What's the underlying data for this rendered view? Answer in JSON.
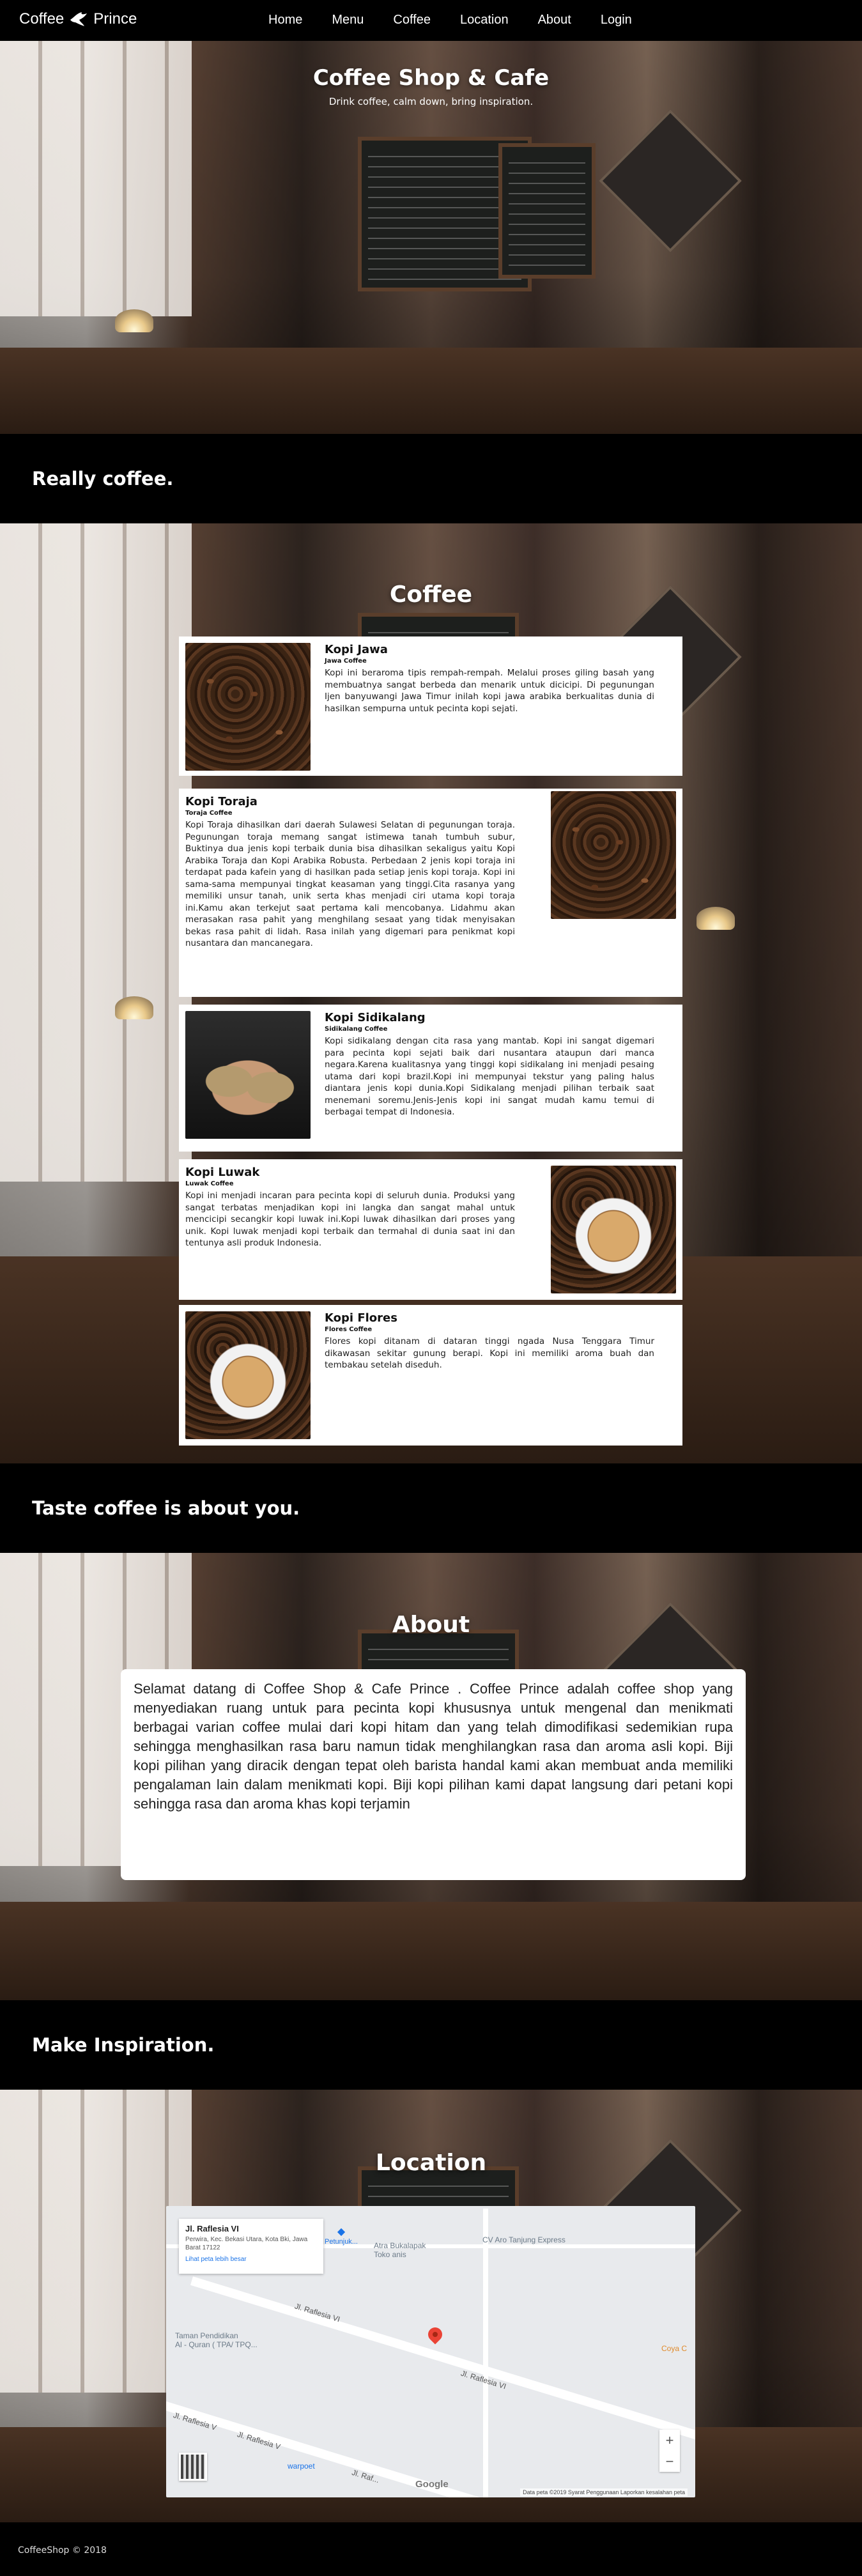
{
  "nav": {
    "brand_left": "Coffee",
    "brand_right": "Prince",
    "links": [
      "Home",
      "Menu",
      "Coffee",
      "Location",
      "About",
      "Login"
    ]
  },
  "hero": {
    "title": "Coffee Shop & Cafe",
    "subtitle": "Drink coffee, calm down, bring inspiration."
  },
  "banners": [
    "Really coffee.",
    "Taste coffee is about you.",
    "Make Inspiration."
  ],
  "coffee": {
    "title": "Coffee",
    "items": [
      {
        "name": "Kopi Jawa",
        "sub": "Jawa Coffee",
        "desc": "Kopi ini beraroma tipis rempah-rempah. Melalui proses giling basah yang membuatnya sangat berbeda dan menarik untuk dicicipi. Di pegunungan Ijen banyuwangi Jawa Timur inilah kopi jawa arabika berkualitas dunia di hasilkan sempurna untuk pecinta kopi sejati."
      },
      {
        "name": "Kopi Toraja",
        "sub": "Toraja Coffee",
        "desc": "Kopi Toraja dihasilkan dari daerah Sulawesi Selatan di pegunungan toraja. Pegunungan toraja memang sangat istimewa tanah tumbuh subur, Buktinya dua jenis kopi terbaik dunia bisa dihasilkan sekaligus yaitu Kopi Arabika Toraja dan Kopi Arabika Robusta. Perbedaan 2 jenis kopi toraja ini terdapat pada kafein yang di hasilkan pada setiap jenis kopi toraja. Kopi ini sama-sama mempunyai tingkat keasaman yang tinggi.Cita rasanya yang memiliki unsur tanah, unik serta khas menjadi ciri utama kopi toraja ini.Kamu akan terkejut saat pertama kali mencobanya. Lidahmu akan merasakan rasa pahit yang menghilang sesaat yang tidak menyisakan bekas rasa pahit di lidah. Rasa inilah yang digemari para penikmat kopi nusantara dan mancanegara."
      },
      {
        "name": "Kopi Sidikalang",
        "sub": "Sidikalang Coffee",
        "desc": "Kopi sidikalang dengan cita rasa yang mantab. Kopi ini sangat digemari para pecinta kopi sejati baik dari nusantara ataupun dari manca negara.Karena kualitasnya yang tinggi kopi sidikalang ini menjadi pesaing utama dari kopi brazil.Kopi ini mempunyai tekstur yang paling halus diantara jenis kopi dunia.Kopi Sidikalang menjadi pilihan terbaik saat menemani soremu.Jenis-Jenis kopi ini sangat mudah kamu temui di berbagai tempat di Indonesia."
      },
      {
        "name": "Kopi Luwak",
        "sub": "Luwak Coffee",
        "desc": "Kopi ini menjadi incaran para pecinta kopi di seluruh dunia. Produksi yang sangat terbatas menjadikan kopi ini langka dan sangat mahal untuk mencicipi secangkir kopi luwak ini.Kopi luwak dihasilkan dari proses yang unik. Kopi luwak menjadi kopi terbaik dan termahal di dunia saat ini dan tentunya asli produk Indonesia."
      },
      {
        "name": "Kopi Flores",
        "sub": "Flores Coffee",
        "desc": "Flores kopi ditanam di dataran tinggi ngada Nusa Tenggara Timur dikawasan sekitar gunung berapi. Kopi ini memiliki aroma buah dan tembakau setelah diseduh."
      }
    ]
  },
  "about": {
    "title": "About",
    "text": "Selamat datang di Coffee Shop & Cafe Prince . Coffee Prince adalah coffee shop yang menyediakan ruang untuk para pecinta kopi khususnya untuk mengenal dan menikmati berbagai varian coffee mulai dari kopi hitam dan yang telah dimodifikasi sedemikian rupa sehingga menghasilkan rasa baru namun tidak menghilangkan rasa dan aroma asli kopi. Biji kopi pilihan yang diracik dengan tepat oleh barista handal kami akan membuat anda memiliki pengalaman lain dalam menikmati kopi. Biji kopi pilihan kami dapat langsung dari petani kopi sehingga rasa dan aroma khas kopi terjamin"
  },
  "location": {
    "title": "Location",
    "map": {
      "place": "Jl. Raflesia VI",
      "address": "Perwira, Kec. Bekasi Utara, Kota Bki, Jawa Barat 17122",
      "larger_map": "Lihat peta lebih besar",
      "directions": "Petunjuk...",
      "road_labels": [
        "Jl. Raflesia VI",
        "Jl. Raflesia VI",
        "Jl. Raflesia V",
        "Jl. Raflesia V",
        "Jl. Raf..."
      ],
      "pois": [
        "Atra Bukalapak\nToko anis",
        "CV Aro Tanjung Express",
        "Taman Pendidikan\nAl - Quran ( TPA/ TPQ...",
        "Coya C",
        "warpoet"
      ],
      "attribution": "Data peta ©2019   Syarat Penggunaan   Laporkan kesalahan peta",
      "google": "Google",
      "zoom_in": "+",
      "zoom_out": "−"
    }
  },
  "footer": {
    "text": "CoffeeShop © 2018"
  }
}
